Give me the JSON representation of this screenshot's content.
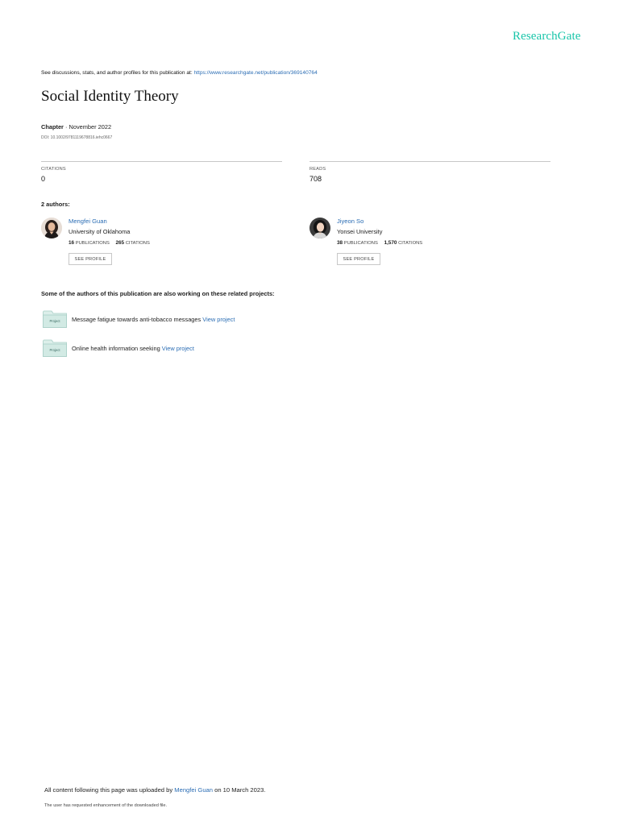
{
  "brand": {
    "name": "ResearchGate",
    "color": "#18c5a9"
  },
  "discussion": {
    "prefix": "See discussions, stats, and author profiles for this publication at:",
    "url": "https://www.researchgate.net/publication/369140764"
  },
  "publication": {
    "title": "Social Identity Theory",
    "type": "Chapter",
    "separator": " · ",
    "date": "November 2022",
    "doi": "DOI: 10.1002/9781119678816.iehc0667"
  },
  "stats": {
    "citations_label": "CITATIONS",
    "citations_value": "0",
    "reads_label": "READS",
    "reads_value": "708"
  },
  "authors_count_label": "2 authors:",
  "authors": [
    {
      "name": "Mengfei Guan",
      "institution": "University of Oklahoma",
      "publications": "16",
      "publications_label": "PUBLICATIONS",
      "citations": "265",
      "citations_label": "CITATIONS",
      "button_label": "SEE PROFILE"
    },
    {
      "name": "Jiyeon So",
      "institution": "Yonsei University",
      "publications": "38",
      "publications_label": "PUBLICATIONS",
      "citations": "1,570",
      "citations_label": "CITATIONS",
      "button_label": "SEE PROFILE"
    }
  ],
  "related_heading": "Some of the authors of this publication are also working on these related projects:",
  "projects": [
    {
      "folder_label": "Project",
      "title": "Message fatigue towards anti-tobacco messages",
      "link_label": "View project"
    },
    {
      "folder_label": "Project",
      "title": "Online health information seeking",
      "link_label": "View project"
    }
  ],
  "footer": {
    "prefix": "All content following this page was uploaded by",
    "uploader": "Mengfei Guan",
    "suffix": "on 10 March 2023.",
    "note": "The user has requested enhancement of the downloaded file."
  }
}
